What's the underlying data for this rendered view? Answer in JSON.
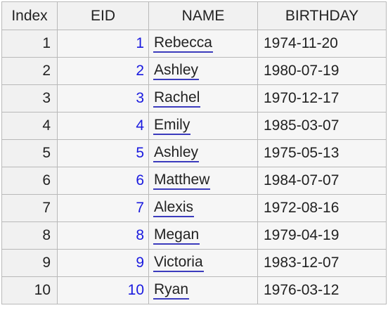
{
  "table": {
    "headers": [
      "Index",
      "EID",
      "NAME",
      "BIRTHDAY"
    ],
    "rows": [
      {
        "index": "1",
        "eid": "1",
        "name": "Rebecca",
        "birthday": "1974-11-20"
      },
      {
        "index": "2",
        "eid": "2",
        "name": "Ashley",
        "birthday": "1980-07-19"
      },
      {
        "index": "3",
        "eid": "3",
        "name": "Rachel",
        "birthday": "1970-12-17"
      },
      {
        "index": "4",
        "eid": "4",
        "name": "Emily",
        "birthday": "1985-03-07"
      },
      {
        "index": "5",
        "eid": "5",
        "name": "Ashley",
        "birthday": "1975-05-13"
      },
      {
        "index": "6",
        "eid": "6",
        "name": "Matthew",
        "birthday": "1984-07-07"
      },
      {
        "index": "7",
        "eid": "7",
        "name": "Alexis",
        "birthday": "1972-08-16"
      },
      {
        "index": "8",
        "eid": "8",
        "name": "Megan",
        "birthday": "1979-04-19"
      },
      {
        "index": "9",
        "eid": "9",
        "name": "Victoria",
        "birthday": "1983-12-07"
      },
      {
        "index": "10",
        "eid": "10",
        "name": "Ryan",
        "birthday": "1976-03-12"
      }
    ]
  },
  "colors": {
    "eid_text": "#1a1adf",
    "name_underline": "#3b3bbd",
    "header_bg": "#f1f1f1",
    "cell_bg": "#f6f6f6",
    "grid_line": "#b9b9b9"
  }
}
